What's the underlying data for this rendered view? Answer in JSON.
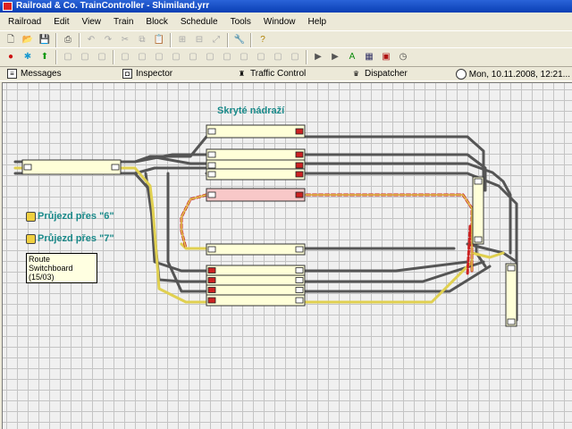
{
  "window": {
    "title": "Railroad & Co. TrainController - Shimiland.yrr"
  },
  "menu": [
    "Railroad",
    "Edit",
    "View",
    "Train",
    "Block",
    "Schedule",
    "Tools",
    "Window",
    "Help"
  ],
  "toolbar1": [
    "new-file-icon",
    "open-folder-icon",
    "save-icon",
    "|",
    "print-icon",
    "|",
    "undo-icon",
    "redo-icon",
    "cut-icon",
    "copy-icon",
    "paste-icon",
    "|",
    "align-icon",
    "align-icon-2",
    "resize-icon",
    "|",
    "wrench-icon",
    "|",
    "help-icon"
  ],
  "toolbar2": [
    "stop-icon",
    "globe-icon",
    "arrow-up-icon",
    "|",
    "tb2-icon",
    "tb2-icon",
    "tb2-icon",
    "|",
    "tb2-icon",
    "tb2-icon",
    "tb2-icon",
    "tb2-icon",
    "tb2-icon",
    "tb2-icon",
    "tb2-icon",
    "tb2-icon",
    "tb2-icon",
    "tb2-icon",
    "tb2-icon",
    "|",
    "play-icon",
    "step-icon",
    "green-a-icon",
    "graph-icon",
    "locomotive-icon",
    "clock-icon"
  ],
  "windows_bar": {
    "messages": "Messages",
    "inspector": "Inspector",
    "traffic": "Traffic Control",
    "dispatcher": "Dispatcher",
    "clock": "Mon, 10.11.2008, 12:21..."
  },
  "layout": {
    "title": "Skryté nádraží",
    "routes": [
      {
        "label": "Průjezd přes \"6\""
      },
      {
        "label": "Průjezd přes \"7\""
      }
    ],
    "tooltip_line1": "Route",
    "tooltip_line2": "Switchboard (15/03)"
  },
  "colors": {
    "track": "#555555",
    "route_active": "#e0d050",
    "route_reserved": "#cc2222",
    "block_free": "#ffffd8",
    "block_occupied": "#f8c8c8"
  }
}
